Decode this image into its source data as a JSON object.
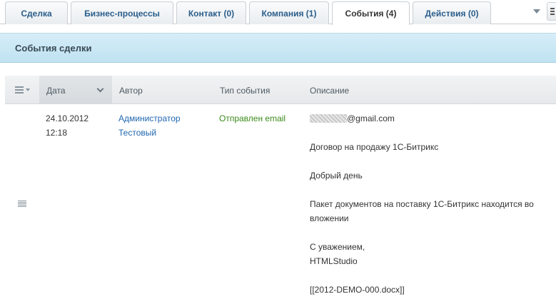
{
  "tabs": [
    {
      "label": "Сделка"
    },
    {
      "label": "Бизнес-процессы"
    },
    {
      "label": "Контакт (0)"
    },
    {
      "label": "Компания (1)"
    },
    {
      "label": "События (4)"
    },
    {
      "label": "Действия (0)"
    }
  ],
  "section": {
    "title": "События сделки"
  },
  "grid": {
    "columns": [
      "Дата",
      "Автор",
      "Тип события",
      "Описание"
    ],
    "rows": [
      {
        "date_line1": "24.10.2012",
        "date_line2": "12:18",
        "author_line1": "Администратор",
        "author_line2": "Тестовый",
        "event_type": "Отправлен email",
        "email_suffix": "@gmail.com",
        "subject": "Договор на продажу 1С-Битрикс",
        "greeting": "Добрый день",
        "body_line1": "Пакет документов на поставку 1С-Битрикс находится во",
        "body_line2": "вложении",
        "closing_line1": "С уважением,",
        "closing_line2": "HTMLStudio",
        "attachment": "[[2012-DEMO-000.docx]]"
      }
    ]
  },
  "icons": [
    "chevron-down-icon",
    "settings-icon",
    "list-menu-icon",
    "drag-handle-icon"
  ]
}
